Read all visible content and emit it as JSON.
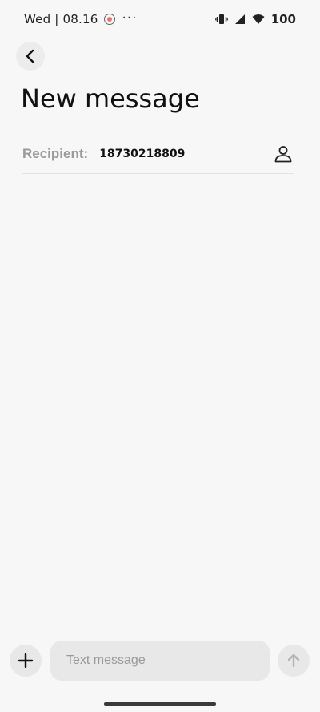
{
  "status_bar": {
    "time": "Wed | 08.16",
    "overflow": "···",
    "battery": "100",
    "icons": {
      "app": "notification-app-icon",
      "vibrate": "vibrate-icon",
      "signal": "signal-icon",
      "wifi": "wifi-icon"
    }
  },
  "header": {
    "back_icon": "chevron-left-icon",
    "title": "New message"
  },
  "recipient": {
    "label": "Recipient:",
    "value": "18730218809",
    "contact_icon": "person-icon"
  },
  "composer": {
    "attach_icon": "plus-icon",
    "placeholder": "Text message",
    "value": "",
    "send_icon": "arrow-up-icon"
  },
  "colors": {
    "background": "#f7f7f7",
    "input_bg": "#e8e8e8",
    "label_gray": "#9a9a9a",
    "text": "#111111"
  }
}
